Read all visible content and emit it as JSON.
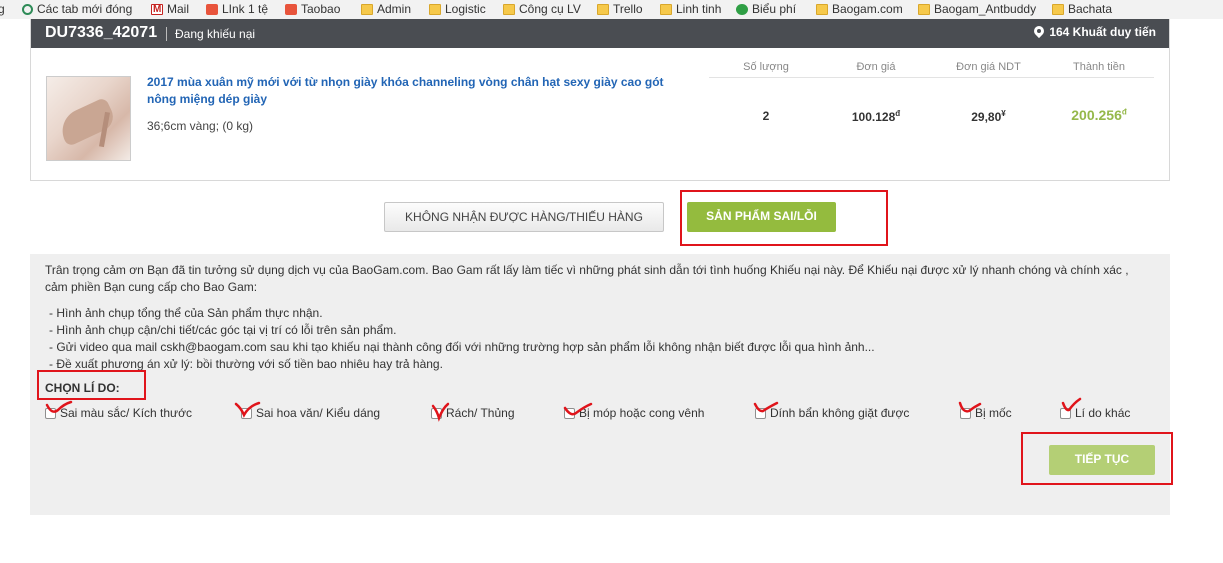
{
  "bookmarks": [
    {
      "label": "g",
      "icon": "page-icon"
    },
    {
      "label": "Các tab mới đóng",
      "icon": "refresh-icon"
    },
    {
      "label": "Mail",
      "icon": "gmail-icon"
    },
    {
      "label": "LInk 1 tệ",
      "icon": "taobao-icon"
    },
    {
      "label": "Taobao",
      "icon": "taobao-icon"
    },
    {
      "label": "Admin",
      "icon": "folder-icon"
    },
    {
      "label": "Logistic",
      "icon": "folder-icon"
    },
    {
      "label": "Công cụ LV",
      "icon": "folder-icon"
    },
    {
      "label": "Trello",
      "icon": "folder-icon"
    },
    {
      "label": "Linh tinh",
      "icon": "folder-icon"
    },
    {
      "label": "Biểu phí",
      "icon": "globe-icon"
    },
    {
      "label": "Baogam.com",
      "icon": "folder-icon"
    },
    {
      "label": "Baogam_Antbuddy",
      "icon": "folder-icon"
    },
    {
      "label": "Bachata",
      "icon": "folder-icon"
    }
  ],
  "order": {
    "id": "DU7336_42071",
    "status": "Đang khiếu nại",
    "address": "164 Khuất duy tiến"
  },
  "product": {
    "name": "2017 mùa xuân mỹ mới với từ nhọn giày khóa channeling vòng chân hạt sexy giày cao gót nông miệng dép giày",
    "attributes": "36;6cm vàng; (0 kg)",
    "columns": [
      "Số lượng",
      "Đơn giá",
      "Đơn giá NDT",
      "Thành tiền"
    ],
    "quantity": "2",
    "unit_price": "100.128",
    "unit_price_suffix": "đ",
    "unit_price_ndt": "29,80",
    "unit_price_ndt_suffix": "¥",
    "total": "200.256",
    "total_suffix": "đ"
  },
  "tabs": {
    "not_received": "KHÔNG NHẬN ĐƯỢC HÀNG/THIẾU HÀNG",
    "wrong_product": "SẢN PHẨM SAI/LỖI"
  },
  "complaint": {
    "intro": "Trân trọng cảm ơn Bạn đã tin tưởng sử dụng dịch vụ của BaoGam.com. Bao Gam rất lấy làm tiếc vì những phát sinh dẫn tới tình huống Khiếu nại này. Để Khiếu nại được xử lý nhanh chóng và chính xác , cảm phiền Bạn cung cấp cho Bao Gam:",
    "bullets": [
      "- Hình ảnh chụp tổng thể của Sản phẩm thực nhận.",
      "- Hình ảnh chụp cận/chi tiết/các góc tại vị trí có lỗi trên sản phẩm.",
      "- Gửi video qua mail cskh@baogam.com sau khi tạo khiếu nại thành công đối với những trường hợp sản phẩm lỗi không nhận biết được lỗi qua hình ảnh...",
      "- Đề xuất phương án xử lý: bồi thường với số tiền bao nhiêu hay trả hàng."
    ],
    "reason_title": "CHỌN LÍ DO:",
    "reasons": [
      "Sai màu sắc/ Kích thước",
      "Sai hoa văn/ Kiểu dáng",
      "Rách/ Thủng",
      "Bị móp hoặc cong vênh",
      "Dính bẩn không giặt được",
      "Bị mốc",
      "Lí do khác"
    ],
    "continue_label": "TIẾP TỤC"
  },
  "annotation_color": "#e0141b",
  "accent_green": "#94bb3e"
}
